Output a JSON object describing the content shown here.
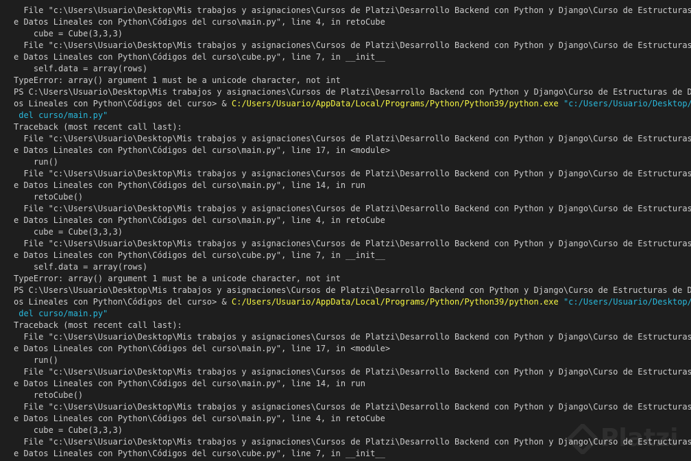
{
  "terminal": {
    "lines": [
      [
        {
          "t": "  File \"c:\\Users\\Usuario\\Desktop\\Mis trabajos y asignaciones\\Cursos de Platzi\\Desarrollo Backend con Python y Django\\Curso de Estructuras d",
          "c": "plain"
        }
      ],
      [
        {
          "t": "e Datos Lineales con Python\\Códigos del curso\\main.py\", line 4, in retoCube",
          "c": "plain"
        }
      ],
      [
        {
          "t": "    cube = Cube(3,3,3)",
          "c": "plain"
        }
      ],
      [
        {
          "t": "  File \"c:\\Users\\Usuario\\Desktop\\Mis trabajos y asignaciones\\Cursos de Platzi\\Desarrollo Backend con Python y Django\\Curso de Estructuras d",
          "c": "plain"
        }
      ],
      [
        {
          "t": "e Datos Lineales con Python\\Códigos del curso\\cube.py\", line 7, in __init__",
          "c": "plain"
        }
      ],
      [
        {
          "t": "    self.data = array(rows)",
          "c": "plain"
        }
      ],
      [
        {
          "t": "TypeError: array() argument 1 must be a unicode character, not int",
          "c": "plain"
        }
      ],
      [
        {
          "t": "PS C:\\Users\\Usuario\\Desktop\\Mis trabajos y asignaciones\\Cursos de Platzi\\Desarrollo Backend con Python y Django\\Curso de Estructuras de Dat",
          "c": "plain"
        }
      ],
      [
        {
          "t": "os Lineales con Python\\Códigos del curso> & ",
          "c": "plain"
        },
        {
          "t": "C:/Users/Usuario/AppData/Local/Programs/Python/Python39/python.exe",
          "c": "cmd"
        },
        {
          "t": " \"c:/Users/Usuario/Desktop/Mi",
          "c": "arg"
        }
      ],
      [
        {
          "t": " del curso/main.py\"",
          "c": "arg"
        }
      ],
      [
        {
          "t": "Traceback (most recent call last):",
          "c": "plain"
        }
      ],
      [
        {
          "t": "  File \"c:\\Users\\Usuario\\Desktop\\Mis trabajos y asignaciones\\Cursos de Platzi\\Desarrollo Backend con Python y Django\\Curso de Estructuras d",
          "c": "plain"
        }
      ],
      [
        {
          "t": "e Datos Lineales con Python\\Códigos del curso\\main.py\", line 17, in <module>",
          "c": "plain"
        }
      ],
      [
        {
          "t": "    run()",
          "c": "plain"
        }
      ],
      [
        {
          "t": "  File \"c:\\Users\\Usuario\\Desktop\\Mis trabajos y asignaciones\\Cursos de Platzi\\Desarrollo Backend con Python y Django\\Curso de Estructuras d",
          "c": "plain"
        }
      ],
      [
        {
          "t": "e Datos Lineales con Python\\Códigos del curso\\main.py\", line 14, in run",
          "c": "plain"
        }
      ],
      [
        {
          "t": "    retoCube()",
          "c": "plain"
        }
      ],
      [
        {
          "t": "  File \"c:\\Users\\Usuario\\Desktop\\Mis trabajos y asignaciones\\Cursos de Platzi\\Desarrollo Backend con Python y Django\\Curso de Estructuras d",
          "c": "plain"
        }
      ],
      [
        {
          "t": "e Datos Lineales con Python\\Códigos del curso\\main.py\", line 4, in retoCube",
          "c": "plain"
        }
      ],
      [
        {
          "t": "    cube = Cube(3,3,3)",
          "c": "plain"
        }
      ],
      [
        {
          "t": "  File \"c:\\Users\\Usuario\\Desktop\\Mis trabajos y asignaciones\\Cursos de Platzi\\Desarrollo Backend con Python y Django\\Curso de Estructuras d",
          "c": "plain"
        }
      ],
      [
        {
          "t": "e Datos Lineales con Python\\Códigos del curso\\cube.py\", line 7, in __init__",
          "c": "plain"
        }
      ],
      [
        {
          "t": "    self.data = array(rows)",
          "c": "plain"
        }
      ],
      [
        {
          "t": "TypeError: array() argument 1 must be a unicode character, not int",
          "c": "plain"
        }
      ],
      [
        {
          "t": "PS C:\\Users\\Usuario\\Desktop\\Mis trabajos y asignaciones\\Cursos de Platzi\\Desarrollo Backend con Python y Django\\Curso de Estructuras de Dat",
          "c": "plain"
        }
      ],
      [
        {
          "t": "os Lineales con Python\\Códigos del curso> & ",
          "c": "plain"
        },
        {
          "t": "C:/Users/Usuario/AppData/Local/Programs/Python/Python39/python.exe",
          "c": "cmd"
        },
        {
          "t": " \"c:/Users/Usuario/Desktop/Mi",
          "c": "arg"
        }
      ],
      [
        {
          "t": " del curso/main.py\"",
          "c": "arg"
        }
      ],
      [
        {
          "t": "Traceback (most recent call last):",
          "c": "plain"
        }
      ],
      [
        {
          "t": "  File \"c:\\Users\\Usuario\\Desktop\\Mis trabajos y asignaciones\\Cursos de Platzi\\Desarrollo Backend con Python y Django\\Curso de Estructuras d",
          "c": "plain"
        }
      ],
      [
        {
          "t": "e Datos Lineales con Python\\Códigos del curso\\main.py\", line 17, in <module>",
          "c": "plain"
        }
      ],
      [
        {
          "t": "    run()",
          "c": "plain"
        }
      ],
      [
        {
          "t": "  File \"c:\\Users\\Usuario\\Desktop\\Mis trabajos y asignaciones\\Cursos de Platzi\\Desarrollo Backend con Python y Django\\Curso de Estructuras d",
          "c": "plain"
        }
      ],
      [
        {
          "t": "e Datos Lineales con Python\\Códigos del curso\\main.py\", line 14, in run",
          "c": "plain"
        }
      ],
      [
        {
          "t": "    retoCube()",
          "c": "plain"
        }
      ],
      [
        {
          "t": "  File \"c:\\Users\\Usuario\\Desktop\\Mis trabajos y asignaciones\\Cursos de Platzi\\Desarrollo Backend con Python y Django\\Curso de Estructuras d",
          "c": "plain"
        }
      ],
      [
        {
          "t": "e Datos Lineales con Python\\Códigos del curso\\main.py\", line 4, in retoCube",
          "c": "plain"
        }
      ],
      [
        {
          "t": "    cube = Cube(3,3,3)",
          "c": "plain"
        }
      ],
      [
        {
          "t": "  File \"c:\\Users\\Usuario\\Desktop\\Mis trabajos y asignaciones\\Cursos de Platzi\\Desarrollo Backend con Python y Django\\Curso de Estructuras d",
          "c": "plain"
        }
      ],
      [
        {
          "t": "e Datos Lineales con Python\\Códigos del curso\\cube.py\", line 7, in __init__",
          "c": "plain"
        }
      ]
    ]
  },
  "watermark": {
    "text": "Platzi",
    "icon": "platzi-logo-icon"
  },
  "colors": {
    "background": "#1e1e1e",
    "text": "#cccccc",
    "command": "#f5f543",
    "argument": "#29b8db"
  }
}
